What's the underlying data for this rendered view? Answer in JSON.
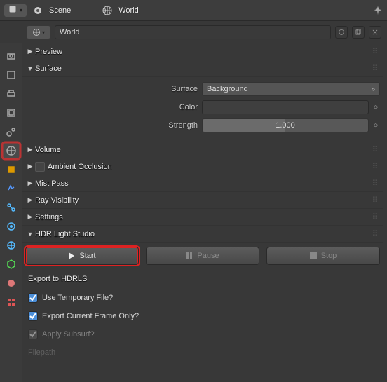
{
  "header": {
    "scene_label": "Scene",
    "world_label": "World"
  },
  "world_selector": {
    "value": "World"
  },
  "panels": {
    "preview": {
      "title": "Preview",
      "expanded": false
    },
    "surface": {
      "title": "Surface",
      "expanded": true,
      "surface_label": "Surface",
      "surface_value": "Background",
      "color_label": "Color",
      "strength_label": "Strength",
      "strength_value": "1.000",
      "strength_fill_pct": 50
    },
    "volume": {
      "title": "Volume",
      "expanded": false
    },
    "ao": {
      "title": "Ambient Occlusion",
      "expanded": false,
      "check": false
    },
    "mist": {
      "title": "Mist Pass",
      "expanded": false
    },
    "ray": {
      "title": "Ray Visibility",
      "expanded": false
    },
    "settings": {
      "title": "Settings",
      "expanded": false
    },
    "hdr": {
      "title": "HDR Light Studio",
      "expanded": true,
      "start_label": "Start",
      "pause_label": "Pause",
      "stop_label": "Stop",
      "export_title": "Export to HDRLS",
      "opt_tempfile": "Use Temporary File?",
      "opt_curframe": "Export Current Frame Only?",
      "opt_subsurf": "Apply Subsurf?",
      "opt_filepath": "Filepath"
    }
  },
  "vtabs": [
    "render",
    "output",
    "printer",
    "layers",
    "image",
    "scene",
    "world",
    "object",
    "wrench",
    "constraints",
    "modifiers",
    "particles",
    "physics",
    "data",
    "material",
    "texture"
  ]
}
